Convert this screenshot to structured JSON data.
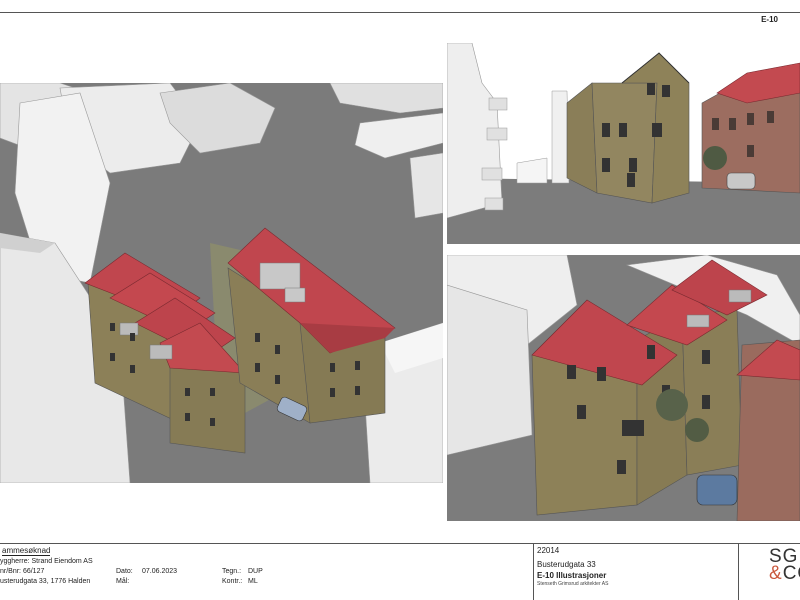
{
  "sheet": {
    "number": "E-10"
  },
  "title_block": {
    "application": "ammesøknad",
    "builder": "yggherre: Strand Eiendom AS",
    "gnr_bnr": "nr/Bnr:  66/127",
    "address": "usterudgata 33, 1776 Halden",
    "date_label": "Dato:",
    "date_value": "07.06.2023",
    "scale_label": "Mål:",
    "drawn_label": "Tegn.:",
    "drawn_value": "DUP",
    "checked_label": "Kontr.:",
    "checked_value": "ML",
    "project_number": "22014",
    "project_address": "Busterudgata 33",
    "drawing_title": "E-10  Illustrasjoner",
    "firm_name": "Stenseth Grimsrud arkitekter AS"
  },
  "logo": {
    "line1": "SG",
    "amp": "&",
    "line2": "CO"
  },
  "colors": {
    "roof": "#c0464e",
    "facade": "#8c8058",
    "road": "#7d7d7d",
    "neighbour": "#e2e2e2",
    "brick": "#9a6b5e"
  }
}
